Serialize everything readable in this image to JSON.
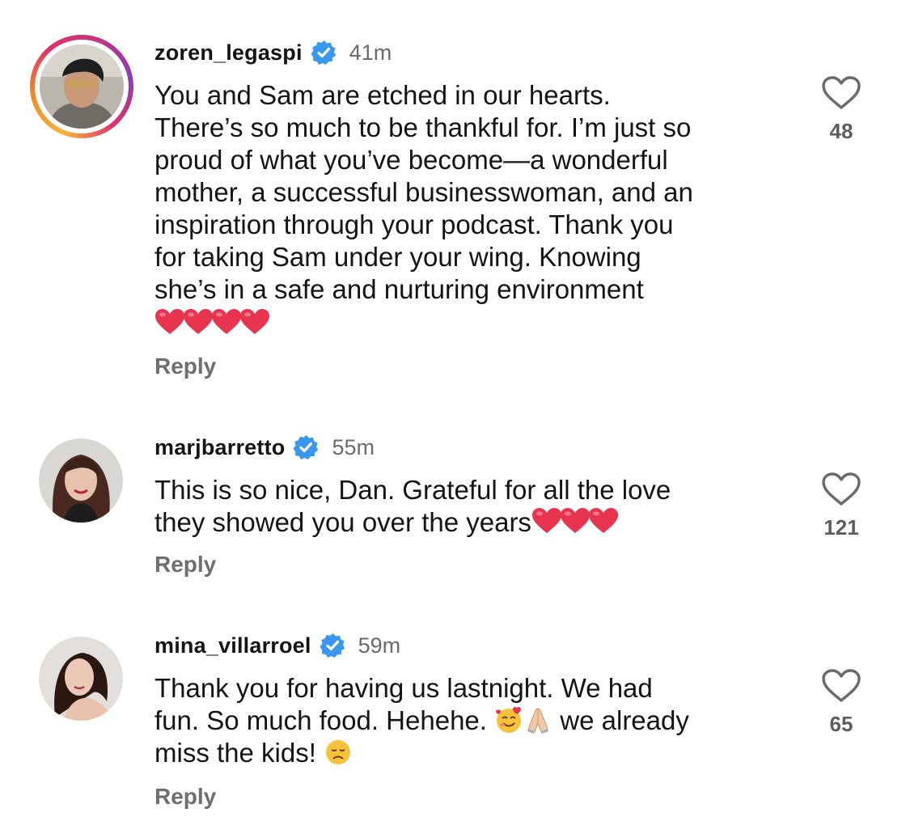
{
  "comments": [
    {
      "username": "zoren_legaspi",
      "verified": true,
      "time": "41m",
      "has_story_ring": true,
      "lines": [
        "You and Sam are etched in our hearts.",
        "There’s so much to be thankful for.  I’m just so",
        "proud of what you’ve become—a wonderful",
        "mother, a successful businesswoman, and an",
        "inspiration through your podcast. Thank you",
        "for taking Sam under your wing. Knowing",
        "she’s in a safe and nurturing environment"
      ],
      "emoji_line": [
        "heart",
        "heart",
        "heart",
        "heart"
      ],
      "reply_label": "Reply",
      "likes": "48",
      "like_icon": "heart-outline-icon"
    },
    {
      "username": "marjbarretto",
      "verified": true,
      "time": "55m",
      "has_story_ring": false,
      "lines": [
        "This is so nice, Dan. Grateful for all the love",
        "they showed you over the years"
      ],
      "trailing_emojis": [
        "heart",
        "heart",
        "heart"
      ],
      "reply_label": "Reply",
      "likes": "121",
      "like_icon": "heart-outline-icon"
    },
    {
      "username": "mina_villarroel",
      "verified": true,
      "time": "59m",
      "has_story_ring": false,
      "lines": [
        "Thank you for having us lastnight. We had",
        "fun. So much food. Hehehe.",
        "miss the kids!"
      ],
      "line2_emojis": [
        "smiling-face-with-hearts",
        "folded-hands"
      ],
      "line2_suffix": " we already",
      "line3_emoji": "disappointed-face",
      "reply_label": "Reply",
      "likes": "65",
      "like_icon": "heart-outline-icon"
    }
  ],
  "colors": {
    "text": "#141414",
    "muted": "#6b6b6b",
    "verified_blue": "#3897f0",
    "heart_red": "#e8344e"
  }
}
